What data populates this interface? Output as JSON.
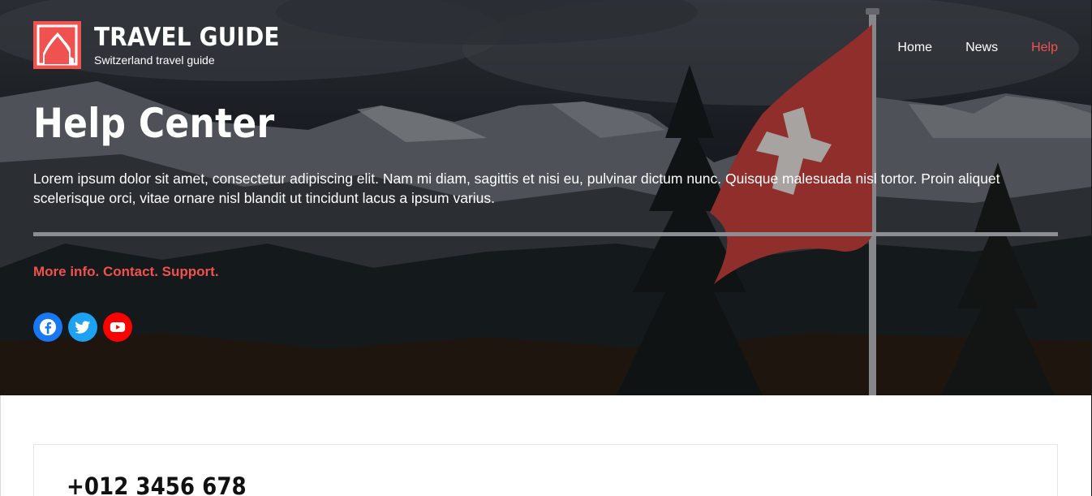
{
  "site": {
    "title": "TRAVEL GUIDE",
    "subtitle": "Switzerland travel guide",
    "logo_icon": "mountain-logo-icon",
    "accent_color": "#f0524f"
  },
  "nav": {
    "items": [
      {
        "label": "Home",
        "active": false
      },
      {
        "label": "News",
        "active": false
      },
      {
        "label": "Help",
        "active": true
      }
    ]
  },
  "hero": {
    "title": "Help Center",
    "intro": "Lorem ipsum dolor sit amet, consectetur adipiscing elit. Nam mi diam, sagittis et nisi eu, pulvinar dictum nunc. Quisque malesuada nisl tortor. Proin aliquet scelerisque orci, vitae ornare nisl blandit ut tincidunt lacus a ipsum varius.",
    "tagline": "More info. Contact. Support.",
    "background": "mountains-with-swiss-flag"
  },
  "socials": [
    {
      "name": "facebook-icon",
      "color": "#1877f2"
    },
    {
      "name": "twitter-icon",
      "color": "#1da1f2"
    },
    {
      "name": "youtube-icon",
      "color": "#ff0000"
    }
  ],
  "contact": {
    "phone": "+012 3456 678"
  }
}
